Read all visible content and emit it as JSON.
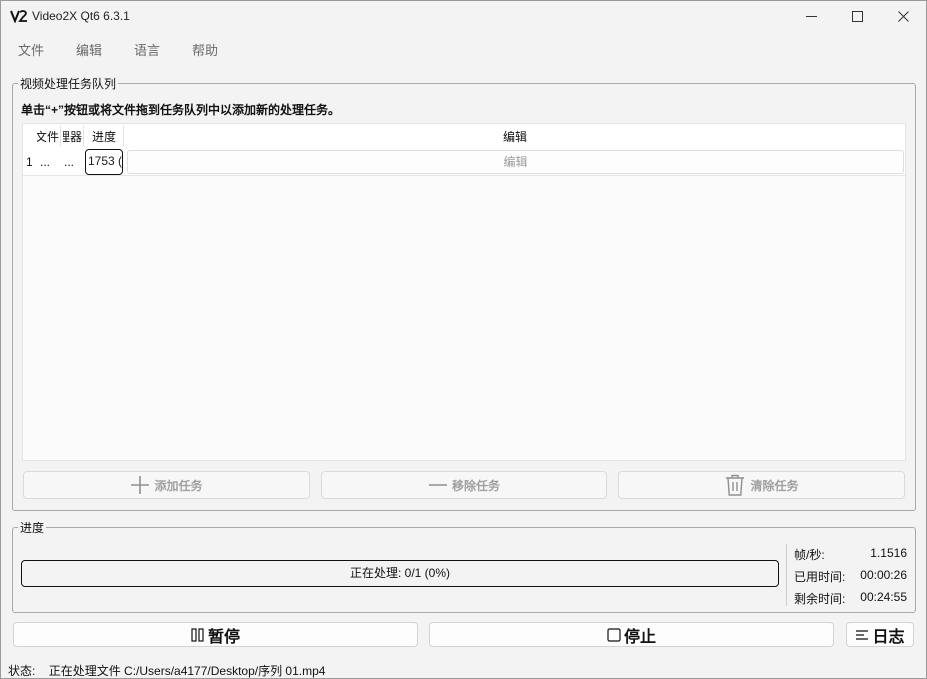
{
  "window": {
    "title": "Video2X Qt6 6.3.1",
    "logo_text": "V2"
  },
  "menu": {
    "items": [
      {
        "label": "文件"
      },
      {
        "label": "编辑"
      },
      {
        "label": "语言"
      },
      {
        "label": "帮助"
      }
    ]
  },
  "queue": {
    "group_title": "视频处理任务队列",
    "hint": "单击“+”按钮或将文件拖到任务队列中以添加新的处理任务。",
    "columns": [
      "文件",
      "处理器",
      "进度",
      "编辑"
    ],
    "rows": [
      {
        "index": "1",
        "file": "...",
        "processor": "...",
        "progress": "1753 (",
        "edit": "编辑"
      }
    ],
    "add_label": "添加任务",
    "remove_label": "移除任务",
    "clear_label": "清除任务"
  },
  "progress": {
    "group_title": "进度",
    "bar_text": "正在处理: 0/1 (0%)",
    "bar_fraction": 0,
    "fps_label": "帧/秒:",
    "fps_value": "1.1516",
    "elapsed_label": "已用时间:",
    "elapsed_value": "00:00:26",
    "remaining_label": "剩余时间:",
    "remaining_value": "00:24:55"
  },
  "controls": {
    "pause_label": "暂停",
    "stop_label": "停止",
    "log_label": "日志"
  },
  "status": {
    "label": "状态:",
    "text": "正在处理文件 C:/Users/a4177/Desktop/序列 01.mp4"
  }
}
